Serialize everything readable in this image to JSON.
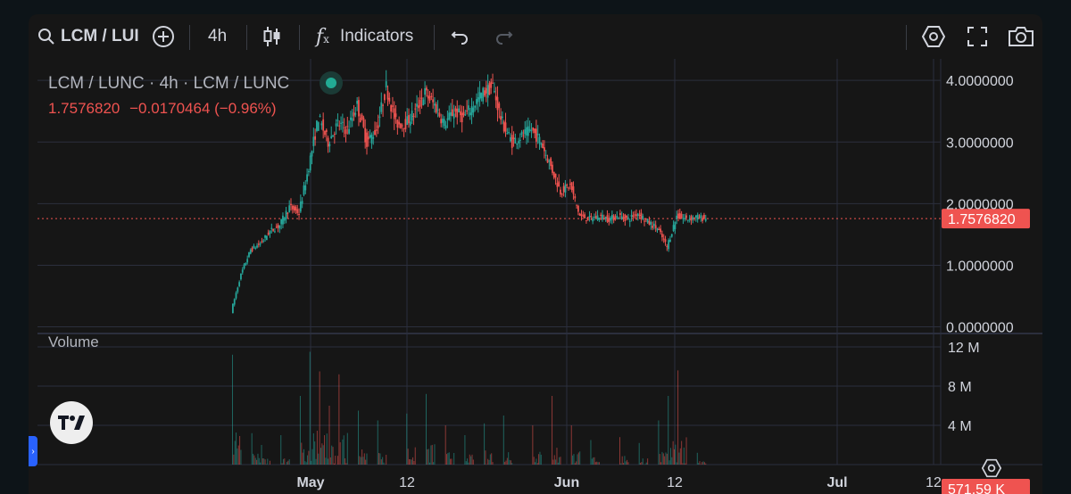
{
  "toolbar": {
    "symbol": "LCM / LUI",
    "interval": "4h",
    "indicators_label": "Indicators"
  },
  "legend": {
    "title": "LCM / LUNC · 4h · LCM / LUNC",
    "price": "1.7576820",
    "change": "−0.0170464 (−0.96%)"
  },
  "volume_label": "Volume",
  "colors": {
    "up": "#26a69a",
    "down": "#ef5350",
    "accent": "#2962ff",
    "status": "#22ab94"
  },
  "chart_data": {
    "type": "candlestick",
    "x_tick_labels": [
      "May",
      "12",
      "Jun",
      "12",
      "Jul",
      "12"
    ],
    "price_axis": {
      "ticks": [
        "4.0000000",
        "3.0000000",
        "2.0000000",
        "1.0000000",
        "0.0000000"
      ],
      "range": [
        -0.05,
        4.35
      ]
    },
    "volume_axis": {
      "ticks": [
        "12 M",
        "8 M",
        "4 M"
      ],
      "range": [
        0,
        13000000
      ]
    },
    "last_price": 1.757682,
    "last_price_label": "1.7576820",
    "last_volume_label": "571.59 K",
    "series": [
      {
        "day": 0,
        "close": 0.25
      },
      {
        "day": 1,
        "close": 0.85
      },
      {
        "day": 2,
        "close": 1.25
      },
      {
        "day": 3,
        "close": 1.35
      },
      {
        "day": 4,
        "close": 1.55
      },
      {
        "day": 5,
        "close": 1.65
      },
      {
        "day": 6,
        "close": 1.95
      },
      {
        "day": 7,
        "close": 1.85
      },
      {
        "day": 8,
        "close": 2.6
      },
      {
        "day": 9,
        "close": 3.4
      },
      {
        "day": 10,
        "close": 3.0
      },
      {
        "day": 11,
        "close": 3.3
      },
      {
        "day": 12,
        "close": 3.2
      },
      {
        "day": 13,
        "close": 3.6
      },
      {
        "day": 14,
        "close": 3.0
      },
      {
        "day": 15,
        "close": 3.2
      },
      {
        "day": 16,
        "close": 3.9
      },
      {
        "day": 17,
        "close": 3.3
      },
      {
        "day": 18,
        "close": 3.3
      },
      {
        "day": 19,
        "close": 3.5
      },
      {
        "day": 20,
        "close": 3.8
      },
      {
        "day": 21,
        "close": 3.6
      },
      {
        "day": 22,
        "close": 3.3
      },
      {
        "day": 23,
        "close": 3.5
      },
      {
        "day": 24,
        "close": 3.4
      },
      {
        "day": 25,
        "close": 3.6
      },
      {
        "day": 26,
        "close": 3.8
      },
      {
        "day": 27,
        "close": 3.9
      },
      {
        "day": 28,
        "close": 3.3
      },
      {
        "day": 29,
        "close": 3.0
      },
      {
        "day": 30,
        "close": 3.1
      },
      {
        "day": 31,
        "close": 3.2
      },
      {
        "day": 32,
        "close": 3.0
      },
      {
        "day": 33,
        "close": 2.6
      },
      {
        "day": 34,
        "close": 2.2
      },
      {
        "day": 35,
        "close": 2.3
      },
      {
        "day": 36,
        "close": 1.8
      },
      {
        "day": 37,
        "close": 1.75
      },
      {
        "day": 38,
        "close": 1.8
      },
      {
        "day": 39,
        "close": 1.75
      },
      {
        "day": 40,
        "close": 1.8
      },
      {
        "day": 41,
        "close": 1.75
      },
      {
        "day": 42,
        "close": 1.85
      },
      {
        "day": 43,
        "close": 1.7
      },
      {
        "day": 44,
        "close": 1.6
      },
      {
        "day": 45,
        "close": 1.3
      },
      {
        "day": 46,
        "close": 1.8
      },
      {
        "day": 47,
        "close": 1.75
      },
      {
        "day": 48,
        "close": 1.78
      },
      {
        "day": 49,
        "close": 1.76
      }
    ],
    "volume_days": [
      {
        "day": 0,
        "volume": 11.2
      },
      {
        "day": 2,
        "volume": 3.2
      },
      {
        "day": 3,
        "volume": 2.0
      },
      {
        "day": 5,
        "volume": 3.0
      },
      {
        "day": 7,
        "volume": 7.0
      },
      {
        "day": 8,
        "volume": 11.5
      },
      {
        "day": 9,
        "volume": 9.5
      },
      {
        "day": 10,
        "volume": 6.0
      },
      {
        "day": 11,
        "volume": 9.2
      },
      {
        "day": 13,
        "volume": 5.5
      },
      {
        "day": 15,
        "volume": 4.5
      },
      {
        "day": 18,
        "volume": 5.2
      },
      {
        "day": 20,
        "volume": 7.2
      },
      {
        "day": 22,
        "volume": 4.0
      },
      {
        "day": 24,
        "volume": 3.0
      },
      {
        "day": 26,
        "volume": 4.2
      },
      {
        "day": 28,
        "volume": 5.0
      },
      {
        "day": 31,
        "volume": 4.0
      },
      {
        "day": 33,
        "volume": 7.0
      },
      {
        "day": 35,
        "volume": 4.0
      },
      {
        "day": 37,
        "volume": 2.5
      },
      {
        "day": 40,
        "volume": 2.8
      },
      {
        "day": 42,
        "volume": 2.2
      },
      {
        "day": 44,
        "volume": 4.5
      },
      {
        "day": 45,
        "volume": 7.0
      },
      {
        "day": 46,
        "volume": 9.6
      },
      {
        "day": 48,
        "volume": 1.2
      }
    ]
  }
}
